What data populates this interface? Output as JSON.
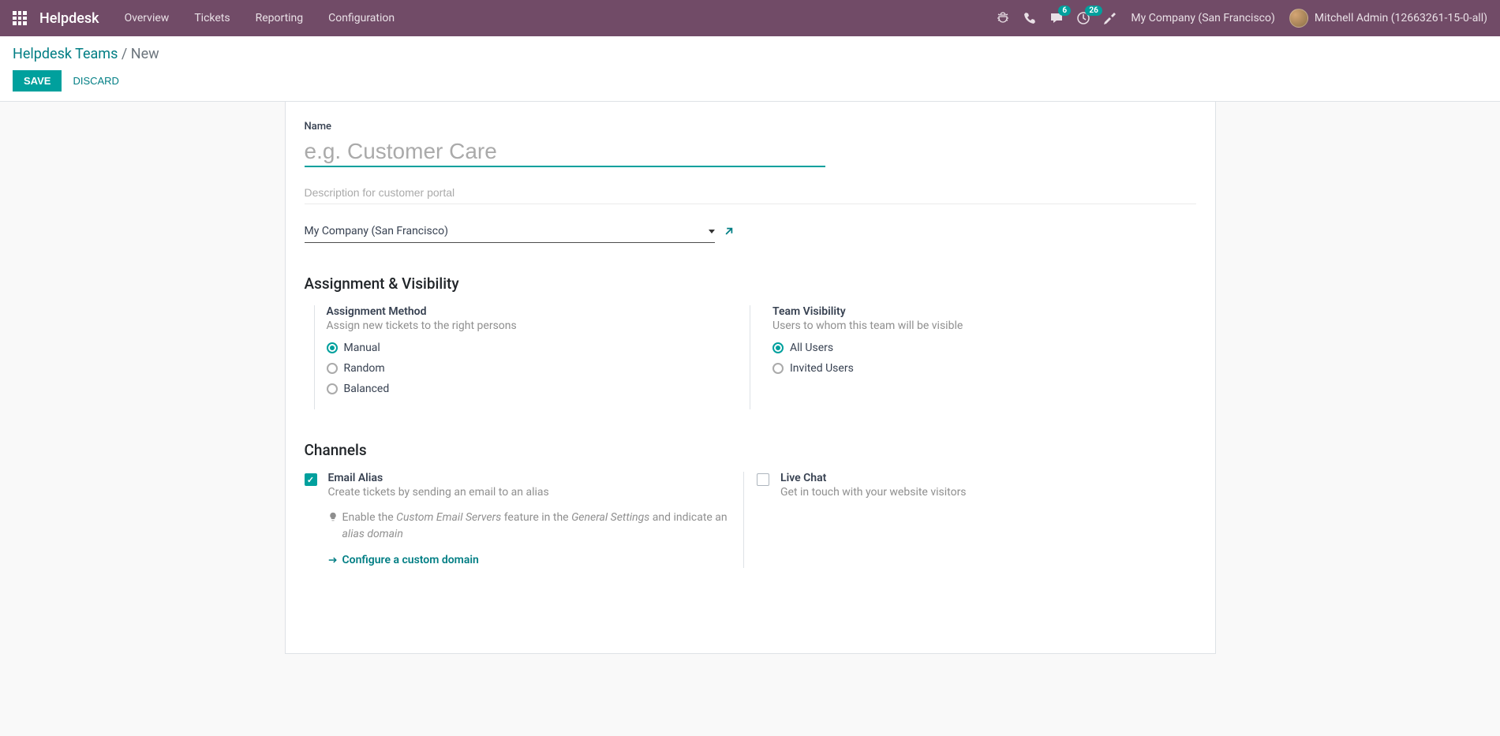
{
  "nav": {
    "brand": "Helpdesk",
    "menu": [
      "Overview",
      "Tickets",
      "Reporting",
      "Configuration"
    ],
    "messages_badge": "6",
    "activities_badge": "26",
    "company": "My Company (San Francisco)",
    "user": "Mitchell Admin (12663261-15-0-all)"
  },
  "breadcrumb": {
    "root": "Helpdesk Teams",
    "sep": " / ",
    "current": "New"
  },
  "buttons": {
    "save": "Save",
    "discard": "Discard"
  },
  "form": {
    "name_label": "Name",
    "name_placeholder": "e.g. Customer Care",
    "desc_placeholder": "Description for customer portal",
    "company_value": "My Company (San Francisco)"
  },
  "assignment": {
    "heading": "Assignment & Visibility",
    "method_title": "Assignment Method",
    "method_desc": "Assign new tickets to the right persons",
    "options": [
      "Manual",
      "Random",
      "Balanced"
    ],
    "visibility_title": "Team Visibility",
    "visibility_desc": "Users to whom this team will be visible",
    "vis_options": [
      "All Users",
      "Invited Users"
    ]
  },
  "channels": {
    "heading": "Channels",
    "email": {
      "title": "Email Alias",
      "desc": "Create tickets by sending an email to an alias",
      "hint_pre": "Enable the ",
      "hint_em1": "Custom Email Servers",
      "hint_mid": " feature in the ",
      "hint_em2": "General Settings",
      "hint_mid2": " and indicate an ",
      "hint_em3": "alias domain",
      "config_link": "Configure a custom domain"
    },
    "livechat": {
      "title": "Live Chat",
      "desc": "Get in touch with your website visitors"
    }
  }
}
